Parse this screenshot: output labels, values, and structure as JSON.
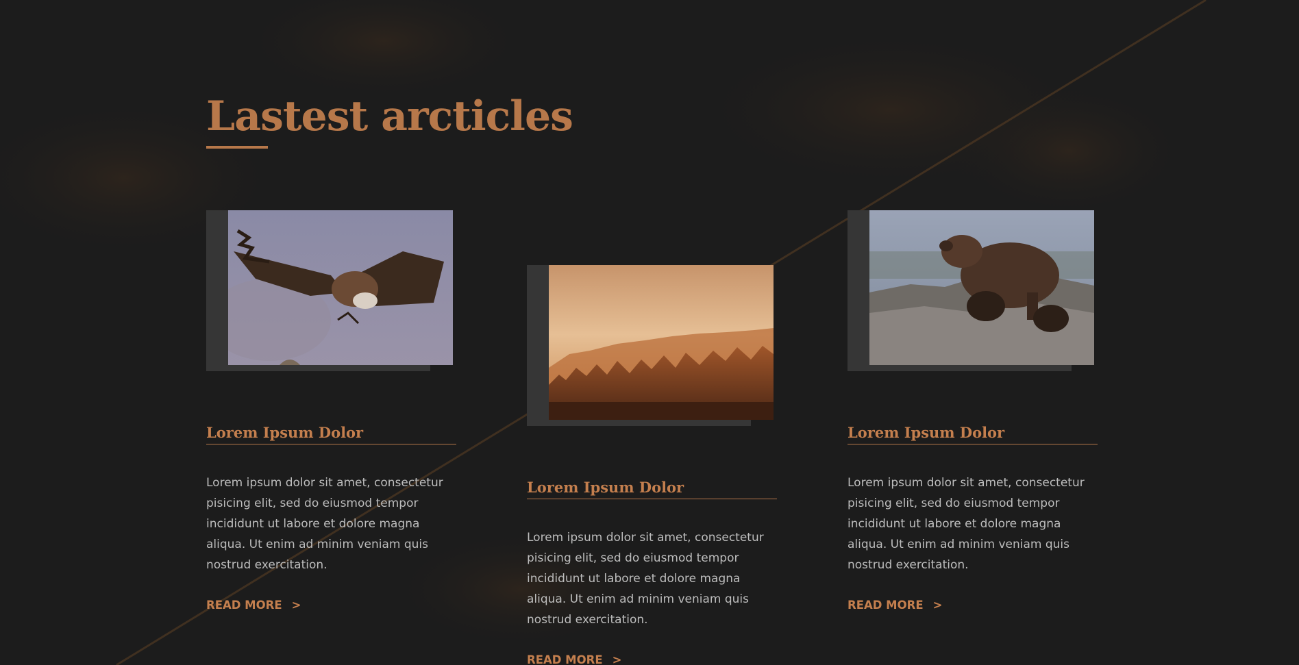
{
  "section": {
    "title": "Lastest arcticles"
  },
  "colors": {
    "background": "#1c1c1c",
    "accent": "#b7784a",
    "frame": "#363636",
    "body_text": "#bdbdbd"
  },
  "articles": [
    {
      "image": "vulture-in-flight-photo",
      "title": "Lorem Ipsum Dolor",
      "text": "Lorem ipsum dolor sit amet, consectetur pisicing elit, sed do eiusmod tempor incididunt ut labore et dolore magna aliqua. Ut enim ad minim veniam quis nostrud exercitation.",
      "read_more": "READ MORE",
      "arrow": ">"
    },
    {
      "image": "misty-forest-sunrise-photo",
      "title": "Lorem Ipsum Dolor",
      "text": "Lorem ipsum dolor sit amet, consectetur pisicing elit, sed do eiusmod tempor incididunt ut labore et dolore magna aliqua. Ut enim ad minim veniam quis nostrud exercitation.",
      "read_more": "READ MORE",
      "arrow": ">"
    },
    {
      "image": "bear-with-cubs-photo",
      "title": "Lorem Ipsum Dolor",
      "text": "Lorem ipsum dolor sit amet, consectetur pisicing elit, sed do eiusmod tempor incididunt ut labore et dolore magna aliqua. Ut enim ad minim veniam quis nostrud exercitation.",
      "read_more": "READ MORE",
      "arrow": ">"
    }
  ]
}
